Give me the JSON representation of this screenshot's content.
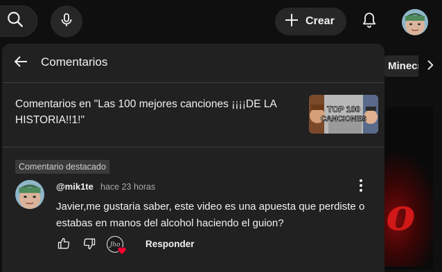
{
  "topbar": {
    "create_label": "Crear"
  },
  "chips": {
    "visible_chip": "Minecraft"
  },
  "panel": {
    "title": "Comentarios",
    "context_text": "Comentarios en \"Las 100 mejores canciones ¡¡¡¡DE LA HISTORIA!!1!\"",
    "thumb_line1": "TOP 100",
    "thumb_line2": "CANCIONES"
  },
  "comment": {
    "pinned_label": "Comentario destacado",
    "author": "@mik1te",
    "time": "hace 23 horas",
    "text": "Javier,me gustaria saber, este video es una apuesta que perdiste o estabas en manos del alcohol haciendo el guion?",
    "reply_label": "Responder"
  },
  "colors": {
    "panel_bg": "#212121",
    "page_bg": "#0f0f0f",
    "accent_red": "#d01818"
  }
}
